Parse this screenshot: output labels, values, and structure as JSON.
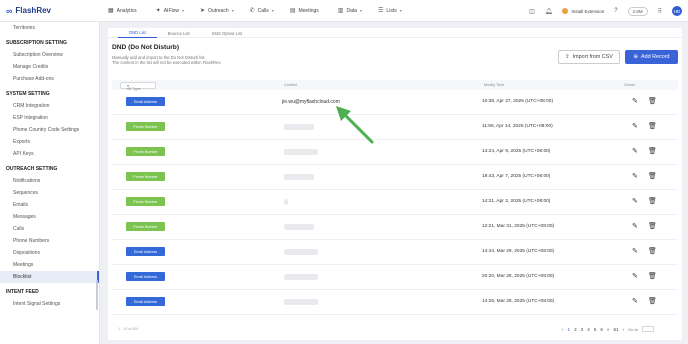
{
  "app": {
    "logo_mark": "∞",
    "logo_text": "FlashRev"
  },
  "nav": [
    {
      "icon": "▦",
      "label": "Analytics",
      "chevron": ""
    },
    {
      "icon": "✦",
      "label": "AIFlow",
      "chevron": "▾"
    },
    {
      "icon": "➤",
      "label": "Outreach",
      "chevron": "▾"
    },
    {
      "icon": "✆",
      "label": "Calls",
      "chevron": "▾"
    },
    {
      "icon": "▤",
      "label": "Meetings",
      "chevron": ""
    },
    {
      "icon": "▥",
      "label": "Data",
      "chevron": "▾"
    },
    {
      "icon": "☰",
      "label": "Lists",
      "chevron": "▾"
    }
  ],
  "header_tools": {
    "extension_label": "Install Extension",
    "zoom": "2.6M",
    "avatar": "HD"
  },
  "sidebar": {
    "items": [
      {
        "kind": "item",
        "label": "Territories"
      },
      {
        "kind": "section",
        "label": "SUBSCRIPTION SETTING"
      },
      {
        "kind": "item",
        "label": "Subscription Overview"
      },
      {
        "kind": "item",
        "label": "Manage Credits"
      },
      {
        "kind": "item",
        "label": "Purchase Add-ons"
      },
      {
        "kind": "section",
        "label": "SYSTEM SETTING"
      },
      {
        "kind": "item",
        "label": "CRM Integration"
      },
      {
        "kind": "item",
        "label": "ESP Integration"
      },
      {
        "kind": "item",
        "label": "Phone Country Code Settings"
      },
      {
        "kind": "item",
        "label": "Exports"
      },
      {
        "kind": "item",
        "label": "API Keys"
      },
      {
        "kind": "section",
        "label": "OUTREACH SETTING"
      },
      {
        "kind": "item",
        "label": "Notifications"
      },
      {
        "kind": "item",
        "label": "Sequences"
      },
      {
        "kind": "item",
        "label": "Emails"
      },
      {
        "kind": "item",
        "label": "Messages"
      },
      {
        "kind": "item",
        "label": "Calls"
      },
      {
        "kind": "item",
        "label": "Phone Numbers"
      },
      {
        "kind": "item",
        "label": "Dispositions"
      },
      {
        "kind": "item",
        "label": "Meetings"
      },
      {
        "kind": "item",
        "label": "Blocklist",
        "active": true
      },
      {
        "kind": "section",
        "label": "INTENT FEED"
      },
      {
        "kind": "item",
        "label": "Intent Signal Settings"
      }
    ]
  },
  "main": {
    "tabs": [
      {
        "label": "DND List",
        "active": true
      },
      {
        "label": "Bounce List",
        "active": false
      },
      {
        "label": "SMS Optout List",
        "active": false
      }
    ],
    "title": "DND (Do Not Disturb)",
    "description_lines": [
      "Manually add and import to the Do Not Disturb list.",
      "The content in the list will not be executed within FlashRev."
    ],
    "import_button": "Import from CSV",
    "add_button": "Add Record",
    "columns": {
      "type_select": "All Type",
      "content": "Content",
      "time": "Modify Time",
      "owner": "Owner"
    },
    "rows": [
      {
        "type": "Email Address",
        "kind": "email",
        "content": "jie.wu@myflashcloud.com",
        "time": "10:38, Apr 27, 2025 (UTC+08:00)"
      },
      {
        "type": "Phone Number",
        "kind": "phone",
        "content": "",
        "time": "11:55, Apr 14, 2025 (UTC+08:00)"
      },
      {
        "type": "Phone Number",
        "kind": "phone",
        "content": "",
        "time": "14:24, Apr 9, 2025 (UTC+08:00)"
      },
      {
        "type": "Phone Number",
        "kind": "phone",
        "content": "",
        "time": "19:43, Apr 7, 2025 (UTC+08:00)"
      },
      {
        "type": "Phone Number",
        "kind": "phone",
        "content": "",
        "time": "14:21, Apr 2, 2025 (UTC+08:00)"
      },
      {
        "type": "Phone Number",
        "kind": "phone",
        "content": "",
        "time": "12:21, Mar 31, 2025 (UTC+08:00)"
      },
      {
        "type": "Email Address",
        "kind": "email",
        "content": "",
        "time": "14:44, Mar 29, 2025 (UTC+08:00)"
      },
      {
        "type": "Email Address",
        "kind": "email",
        "content": "",
        "time": "20:20, Mar 28, 2025 (UTC+08:00)"
      },
      {
        "type": "Email Address",
        "kind": "email",
        "content": "",
        "time": "14:26, Mar 28, 2025 (UTC+08:00)"
      }
    ],
    "total_text": "1 - 10 of 609",
    "pagination": [
      "‹",
      "1",
      "2",
      "3",
      "4",
      "5",
      "6",
      "»",
      "61",
      "›"
    ],
    "goto_label": "Go to"
  },
  "colors": {
    "accent": "#3a63d8",
    "email_badge": "#3369d8",
    "phone_badge": "#7cc44f",
    "annotation_arrow": "#4caf50"
  }
}
